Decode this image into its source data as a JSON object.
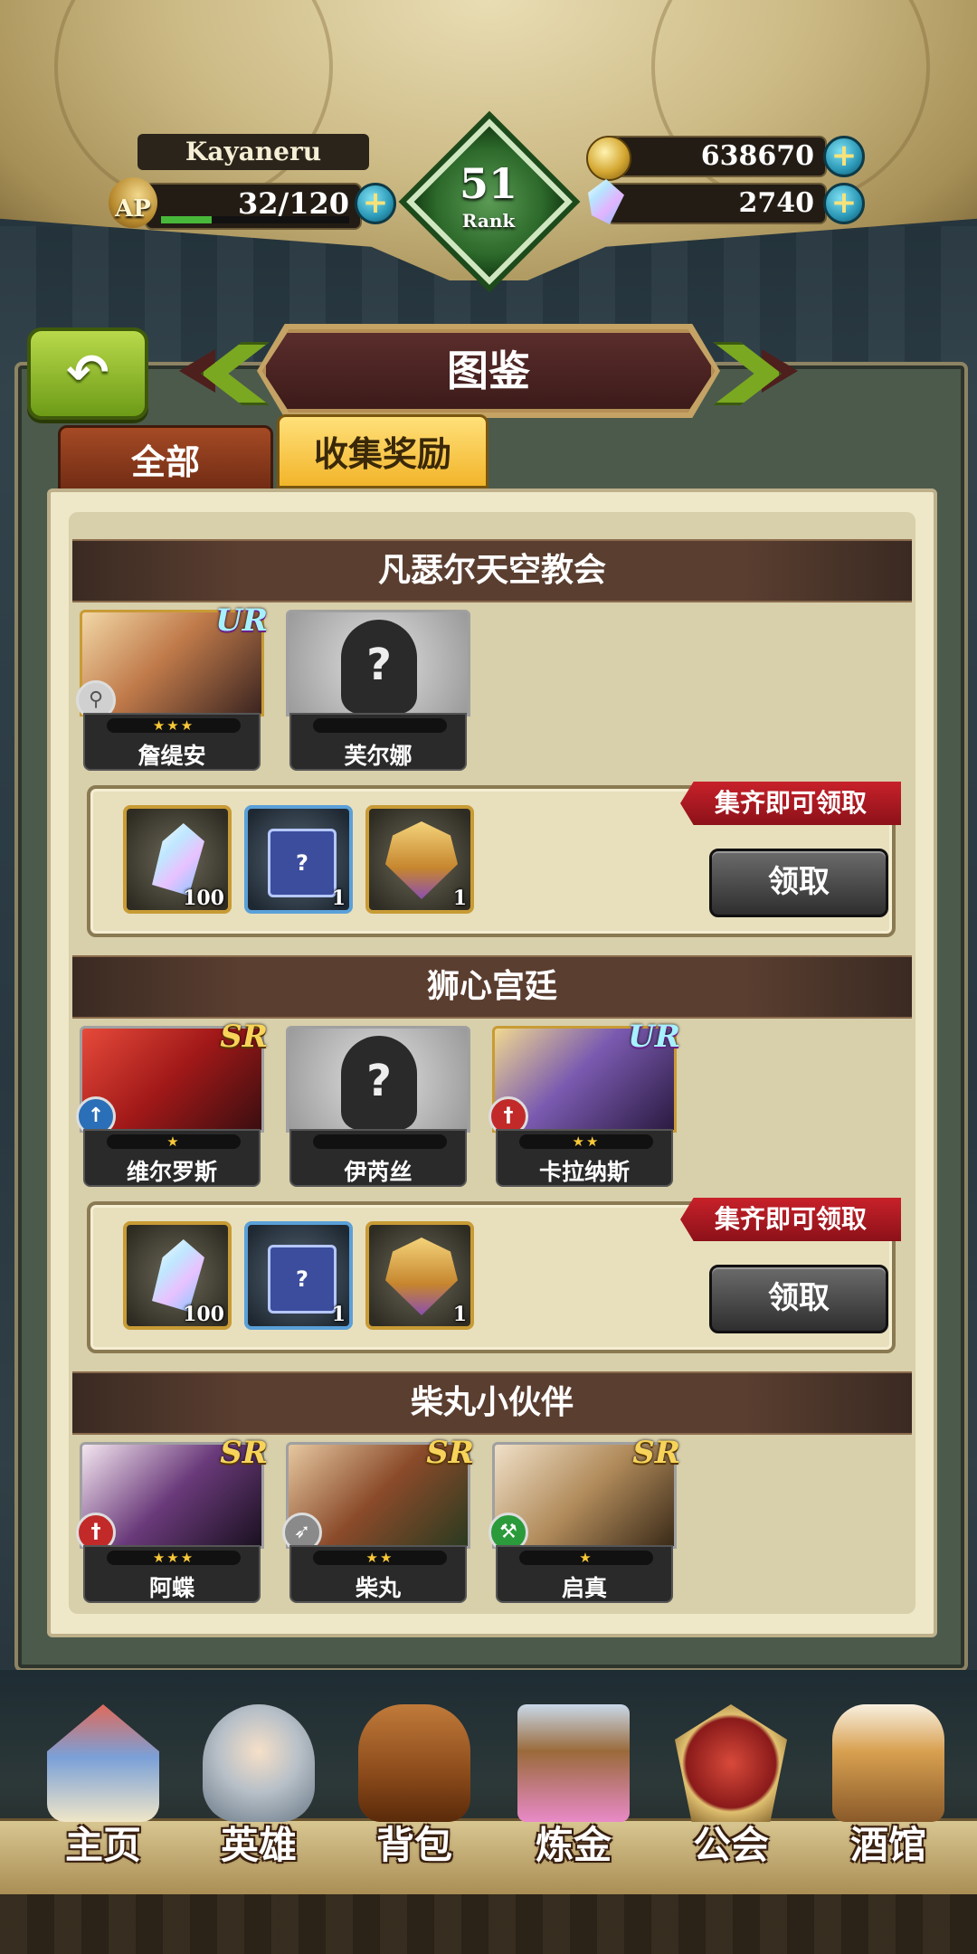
{
  "player": {
    "name": "Kayaneru",
    "ap_label": "AP",
    "ap": "32/120",
    "ap_fraction": 0.27
  },
  "rank": {
    "value": "51",
    "label": "Rank"
  },
  "resources": {
    "gold": "638670",
    "gems": "2740",
    "plus": "+"
  },
  "header": {
    "title": "图鉴",
    "back_icon": "back-arrow-icon"
  },
  "tabs": [
    {
      "label": "全部"
    },
    {
      "label": "收集奖励"
    }
  ],
  "sections": [
    {
      "title": "凡瑟尔天空教会",
      "heroes": [
        {
          "name": "詹缇安",
          "rarity": "UR",
          "stars": "★★★",
          "element": "staff"
        },
        {
          "name": "芙尔娜",
          "rarity": "",
          "stars": "",
          "element": ""
        }
      ],
      "rewards": [
        {
          "icon": "crystal-icon",
          "count": "100"
        },
        {
          "icon": "mystery-box-icon",
          "count": "1"
        },
        {
          "icon": "emblem-icon",
          "count": "1"
        }
      ],
      "tag": "集齐即可领取",
      "claim": "领取"
    },
    {
      "title": "狮心宫廷",
      "heroes": [
        {
          "name": "维尔罗斯",
          "rarity": "SR",
          "stars": "★",
          "element": "spear"
        },
        {
          "name": "伊芮丝",
          "rarity": "",
          "stars": "",
          "element": ""
        },
        {
          "name": "卡拉纳斯",
          "rarity": "UR",
          "stars": "★★",
          "element": "sword"
        }
      ],
      "rewards": [
        {
          "icon": "crystal-icon",
          "count": "100"
        },
        {
          "icon": "mystery-box-icon",
          "count": "1"
        },
        {
          "icon": "emblem-icon",
          "count": "1"
        }
      ],
      "tag": "集齐即可领取",
      "claim": "领取"
    },
    {
      "title": "柴丸小伙伴",
      "heroes": [
        {
          "name": "阿蝶",
          "rarity": "SR",
          "stars": "★★★",
          "element": "sword"
        },
        {
          "name": "柴丸",
          "rarity": "SR",
          "stars": "★★",
          "element": "bow"
        },
        {
          "name": "启真",
          "rarity": "SR",
          "stars": "★",
          "element": "axe"
        }
      ]
    }
  ],
  "nav": [
    {
      "label": "主页"
    },
    {
      "label": "英雄"
    },
    {
      "label": "背包"
    },
    {
      "label": "炼金"
    },
    {
      "label": "公会"
    },
    {
      "label": "酒馆"
    }
  ]
}
